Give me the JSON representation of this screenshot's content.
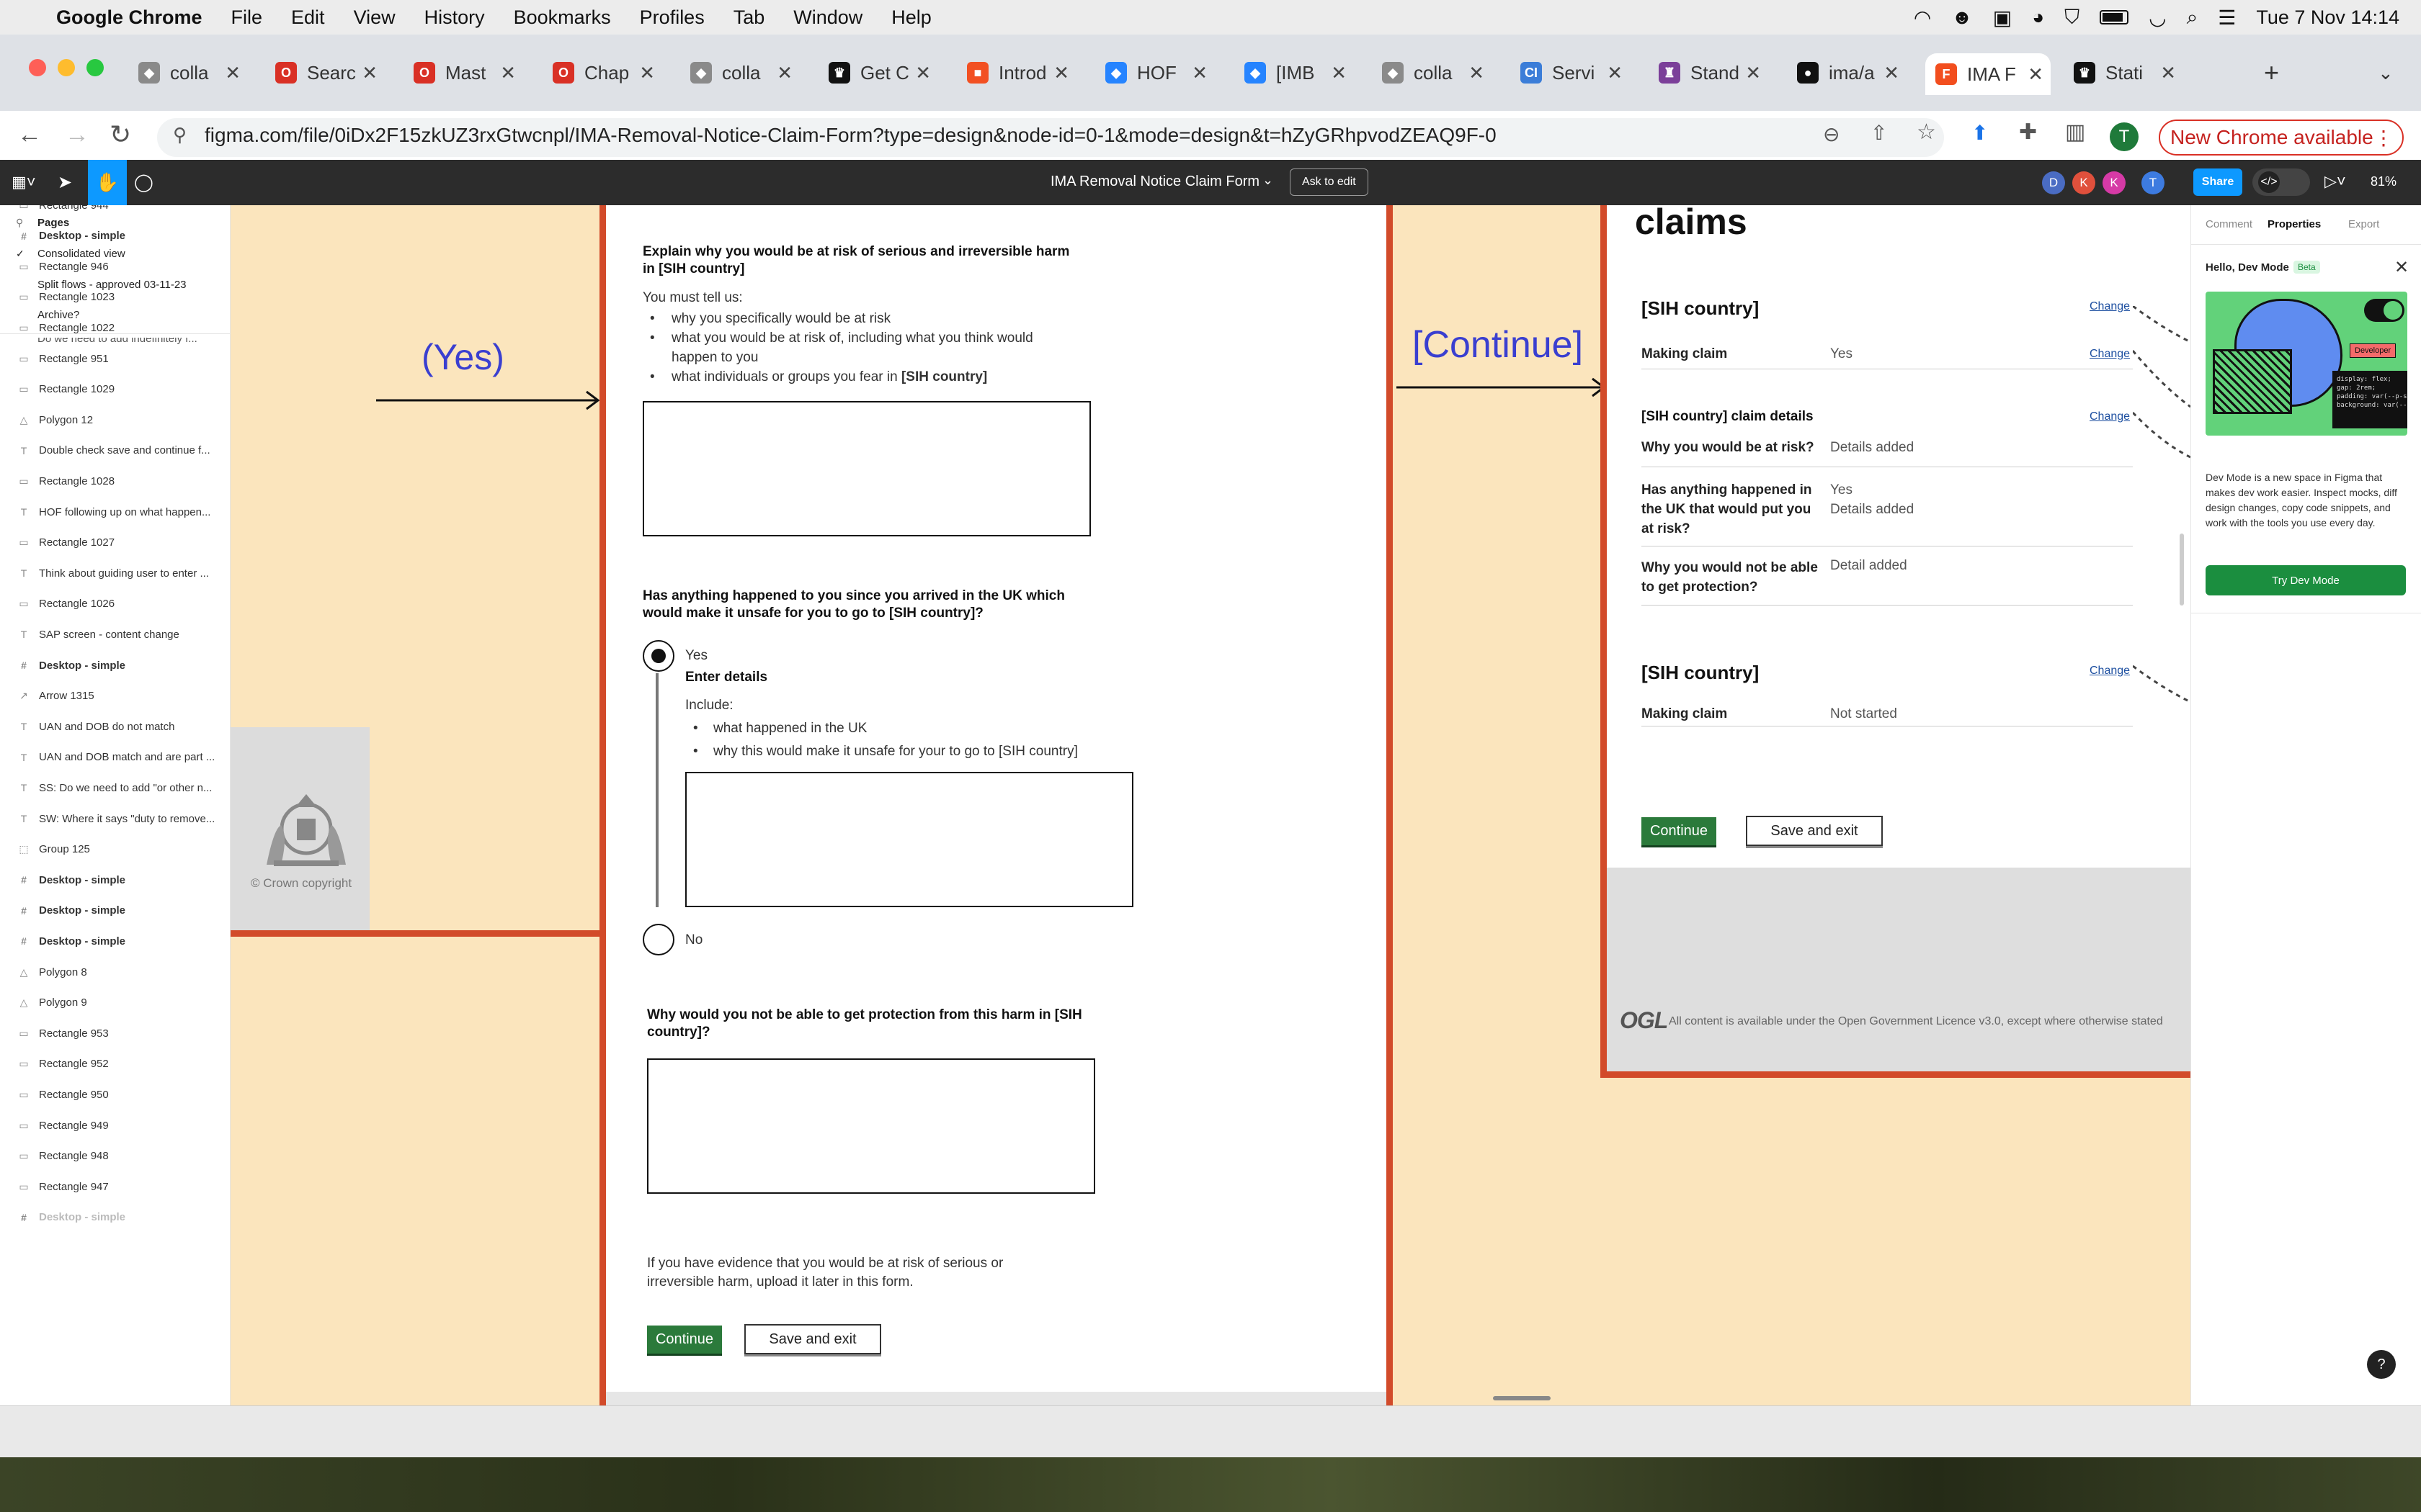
{
  "menubar": {
    "app": "Google Chrome",
    "items": [
      "File",
      "Edit",
      "View",
      "History",
      "Bookmarks",
      "Profiles",
      "Tab",
      "Window",
      "Help"
    ],
    "clock": "Tue 7 Nov  14:14"
  },
  "tabs": [
    {
      "label": "colla",
      "color": "#8a8a8a",
      "glyph": "◆"
    },
    {
      "label": "Searc",
      "color": "#d93025",
      "glyph": "O"
    },
    {
      "label": "Mast",
      "color": "#d93025",
      "glyph": "O"
    },
    {
      "label": "Chap",
      "color": "#d93025",
      "glyph": "O"
    },
    {
      "label": "colla",
      "color": "#8a8a8a",
      "glyph": "◆"
    },
    {
      "label": "Get C",
      "color": "#111111",
      "glyph": "♛"
    },
    {
      "label": "Introd",
      "color": "#f25022",
      "glyph": "■"
    },
    {
      "label": "HOF",
      "color": "#2684ff",
      "glyph": "◆"
    },
    {
      "label": "[IMB",
      "color": "#2684ff",
      "glyph": "◆"
    },
    {
      "label": "colla",
      "color": "#8a8a8a",
      "glyph": "◆"
    },
    {
      "label": "Servi",
      "color": "#3b7dd8",
      "glyph": "CI"
    },
    {
      "label": "Stand",
      "color": "#7b3f99",
      "glyph": "♜"
    },
    {
      "label": "ima/a",
      "color": "#111111",
      "glyph": "●"
    },
    {
      "label": "IMA F",
      "color": "#f24e1e",
      "glyph": "F"
    },
    {
      "label": "Stati",
      "color": "#111111",
      "glyph": "♛"
    }
  ],
  "addressbar": {
    "url": "figma.com/file/0iDx2F15zkUZ3rxGtwcnpl/IMA-Removal-Notice-Claim-Form?type=design&node-id=0-1&mode=design&t=hZyGRhpvodZEAQ9F-0",
    "profile_initial": "T",
    "update_label": "New Chrome available"
  },
  "figma": {
    "file_title": "IMA Removal Notice Claim Form",
    "ask_to_edit": "Ask to edit",
    "avatars": [
      {
        "initial": "D",
        "color": "#4a6cc3"
      },
      {
        "initial": "K",
        "color": "#e0503c"
      },
      {
        "initial": "K",
        "color": "#d63aa6"
      },
      {
        "initial": "T",
        "color": "#3d7be0"
      }
    ],
    "share": "Share",
    "zoom": "81%"
  },
  "left_panel": {
    "pages_header": "Pages",
    "pages": [
      "Consolidated view",
      "Split flows - approved 03-11-23",
      "Archive?"
    ],
    "truncated_row": "Do we need to add indefinitely f...",
    "layers": [
      {
        "icon": "rect",
        "label": "Rectangle 944"
      },
      {
        "icon": "frame",
        "label": "Desktop - simple",
        "bold": true
      },
      {
        "icon": "rect",
        "label": "Rectangle 946"
      },
      {
        "icon": "rect",
        "label": "Rectangle 1023"
      },
      {
        "icon": "rect",
        "label": "Rectangle 1022"
      },
      {
        "icon": "rect",
        "label": "Rectangle 951"
      },
      {
        "icon": "rect",
        "label": "Rectangle 1029"
      },
      {
        "icon": "poly",
        "label": "Polygon 12"
      },
      {
        "icon": "text",
        "label": "Double check save and continue f..."
      },
      {
        "icon": "rect",
        "label": "Rectangle 1028"
      },
      {
        "icon": "text",
        "label": "HOF following up on what happen..."
      },
      {
        "icon": "rect",
        "label": "Rectangle 1027"
      },
      {
        "icon": "text",
        "label": "Think about guiding user to enter ..."
      },
      {
        "icon": "rect",
        "label": "Rectangle 1026"
      },
      {
        "icon": "text",
        "label": "SAP screen - content change"
      },
      {
        "icon": "frame",
        "label": "Desktop - simple",
        "bold": true
      },
      {
        "icon": "arrow",
        "label": "Arrow 1315"
      },
      {
        "icon": "text",
        "label": "UAN and DOB do not match"
      },
      {
        "icon": "text",
        "label": "UAN and DOB match and are part ..."
      },
      {
        "icon": "text",
        "label": "SS: Do we need to add \"or other n..."
      },
      {
        "icon": "text",
        "label": "SW: Where it says \"duty to remove..."
      },
      {
        "icon": "group",
        "label": "Group 125"
      },
      {
        "icon": "frame",
        "label": "Desktop - simple",
        "bold": true
      },
      {
        "icon": "frame",
        "label": "Desktop - simple",
        "bold": true
      },
      {
        "icon": "frame",
        "label": "Desktop - simple",
        "bold": true
      },
      {
        "icon": "poly",
        "label": "Polygon 8"
      },
      {
        "icon": "poly",
        "label": "Polygon 9"
      },
      {
        "icon": "rect",
        "label": "Rectangle 953"
      },
      {
        "icon": "rect",
        "label": "Rectangle 952"
      },
      {
        "icon": "rect",
        "label": "Rectangle 950"
      },
      {
        "icon": "rect",
        "label": "Rectangle 949"
      },
      {
        "icon": "rect",
        "label": "Rectangle 948"
      },
      {
        "icon": "rect",
        "label": "Rectangle 947"
      },
      {
        "icon": "frame",
        "label": "Desktop - simple",
        "bold": true,
        "faded": true
      }
    ]
  },
  "canvas": {
    "yes_label": "(Yes)",
    "continue_label": "[Continue]",
    "crown_copyright": "© Crown copyright",
    "form": {
      "q1_title": "Explain why you would be at risk of serious and irreversible harm in [SIH country]",
      "q1_intro": "You must tell us:",
      "q1_bullets": [
        "why you specifically would be at risk",
        "what you would be at risk of, including what you think would happen to you",
        "what individuals or groups you fear in "
      ],
      "q1_bold_country": "[SIH country]",
      "q2_title": "Has anything happened to you since you arrived in the UK which would make it unsafe for you to go to  [SIH country]?",
      "yes": "Yes",
      "enter_details": "Enter details",
      "include": "Include:",
      "include_bullets": [
        "what happened in the UK",
        "why this would make it unsafe for your to go to [SIH country]"
      ],
      "no": "No",
      "q3_title": "Why would you not be able to get protection from this harm in [SIH country]?",
      "evidence": "If you have evidence that you would be at risk of serious or irreversible harm, upload it later in this form.",
      "continue": "Continue",
      "save_exit": "Save and exit"
    },
    "summary": {
      "heading": "claims",
      "section1_title": "[SIH country]",
      "change": "Change",
      "making_claim": "Making claim",
      "making_claim_value": "Yes",
      "details_title": "[SIH country] claim details",
      "rows": [
        {
          "q": "Why you would be at risk?",
          "a": "Details added"
        },
        {
          "q": "Has anything happened in the UK that would put you at risk?",
          "a": "Yes\nDetails added"
        },
        {
          "q": "Why you would not be able to get protection?",
          "a": "Detail added"
        }
      ],
      "section2_title": "[SIH country]",
      "making_claim_value2": "Not started",
      "continue": "Continue",
      "save_exit": "Save and exit",
      "ogl": "OGL",
      "licence": "All content is available under the Open Government Licence v3.0, except where otherwise stated"
    }
  },
  "right_panel": {
    "tabs": [
      "Comment",
      "Properties",
      "Export"
    ],
    "hello": "Hello, Dev Mode",
    "beta": "Beta",
    "developer": "Developer",
    "code_lines": [
      "display: flex;",
      "gap: 2rem;",
      "padding: var(--p-sm);",
      "background: var(--bg-br"
    ],
    "description": "Dev Mode is a new space in Figma that makes dev work easier. Inspect mocks, diff design changes, copy code snippets, and work with the tools you use every day.",
    "try_button": "Try Dev Mode",
    "help": "?"
  }
}
